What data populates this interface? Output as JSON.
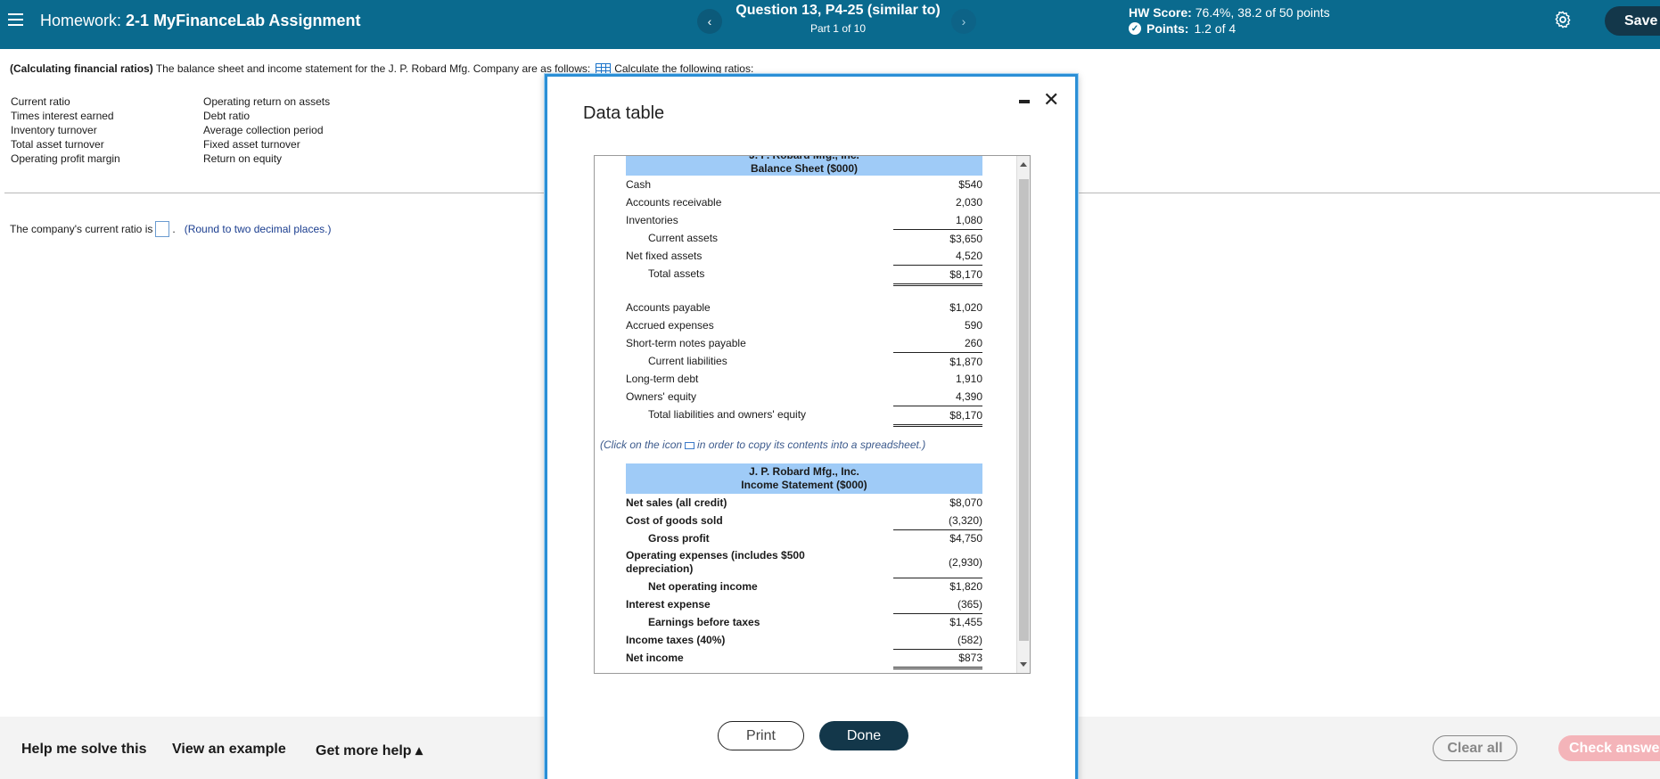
{
  "header": {
    "title_prefix": "Homework:",
    "title_name": "2-1 MyFinanceLab Assignment",
    "question_title": "Question 13, P4-25 (similar to)",
    "question_part": "Part 1 of 10",
    "prev_label": "‹",
    "next_label": "›",
    "hw_score_label": "HW Score:",
    "hw_score_value": "76.4%, 38.2 of 50 points",
    "points_label": "Points:",
    "points_value": "1.2 of 4",
    "save_label": "Save"
  },
  "question": {
    "prompt_bold": "(Calculating financial ratios)",
    "prompt_text": "The balance sheet and income statement for the J. P. Robard Mfg. Company are as follows:",
    "prompt_after": "Calculate the following ratios:",
    "ratios_col1": [
      "Current ratio",
      "Times interest earned",
      "Inventory turnover",
      "Total asset turnover",
      "Operating profit margin"
    ],
    "ratios_col2": [
      "Operating return on assets",
      "Debt ratio",
      "Average collection period",
      "Fixed asset turnover",
      "Return on equity"
    ],
    "answer_prefix": "The company's current ratio is",
    "answer_suffix": ".",
    "round_note": "(Round to two decimal places.)"
  },
  "footer": {
    "help_solve": "Help me solve this",
    "view_example": "View an example",
    "more_help": "Get more help ▴",
    "clear_all": "Clear all",
    "check_answer": "Check answe"
  },
  "dialog": {
    "title": "Data table",
    "print_label": "Print",
    "done_label": "Done",
    "copy_note_before": "(Click on the icon",
    "copy_note_after": "in order to copy its contents into a spreadsheet.)",
    "balance_sheet": {
      "company": "J. P. Robard Mfg., Inc.",
      "heading": "Balance Sheet ($000)",
      "rows": [
        {
          "label": "Cash",
          "value": "$540"
        },
        {
          "label": "Accounts receivable",
          "value": "2,030"
        },
        {
          "label": "Inventories",
          "value": "1,080"
        },
        {
          "label": "Current assets",
          "value": "$3,650"
        },
        {
          "label": "Net fixed assets",
          "value": "4,520"
        },
        {
          "label": "Total assets",
          "value": "$8,170"
        },
        {
          "label": "Accounts payable",
          "value": "$1,020"
        },
        {
          "label": "Accrued expenses",
          "value": "590"
        },
        {
          "label": "Short-term notes payable",
          "value": "260"
        },
        {
          "label": "Current liabilities",
          "value": "$1,870"
        },
        {
          "label": "Long-term debt",
          "value": "1,910"
        },
        {
          "label": "Owners' equity",
          "value": "4,390"
        },
        {
          "label": "Total liabilities and owners' equity",
          "value": "$8,170"
        }
      ]
    },
    "income_statement": {
      "company": "J. P. Robard Mfg., Inc.",
      "heading": "Income Statement ($000)",
      "rows": [
        {
          "label": "Net sales (all credit)",
          "value": "$8,070"
        },
        {
          "label": "Cost of goods sold",
          "value": "(3,320)"
        },
        {
          "label": "Gross profit",
          "value": "$4,750"
        },
        {
          "label": "Operating expenses (includes $500 depreciation)",
          "value": "(2,930)"
        },
        {
          "label": "Net operating income",
          "value": "$1,820"
        },
        {
          "label": "Interest expense",
          "value": "(365)"
        },
        {
          "label": "Earnings before taxes",
          "value": "$1,455"
        },
        {
          "label": "Income taxes (40%)",
          "value": "(582)"
        },
        {
          "label": "Net income",
          "value": "$873"
        }
      ]
    }
  }
}
